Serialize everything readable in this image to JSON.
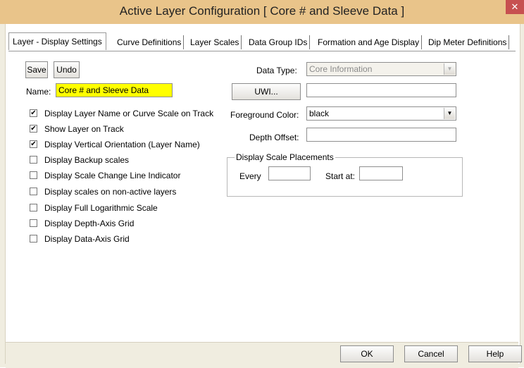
{
  "window": {
    "title": "Active Layer Configuration   [ Core # and Sleeve Data ]",
    "close_glyph": "✕"
  },
  "tabs": [
    {
      "label": "Layer - Display Settings",
      "active": true
    },
    {
      "label": "Curve Definitions"
    },
    {
      "label": "Layer Scales"
    },
    {
      "label": "Data Group IDs"
    },
    {
      "label": "Formation and Age Display"
    },
    {
      "label": "Dip Meter Definitions"
    }
  ],
  "left": {
    "save_label": "Save",
    "undo_label": "Undo",
    "name_label": "Name:",
    "name_value": "Core # and Sleeve Data",
    "checkboxes": [
      {
        "label": "Display Layer Name or Curve Scale on Track",
        "checked": true
      },
      {
        "label": "Show Layer on Track",
        "checked": true
      },
      {
        "label": "Display Vertical Orientation (Layer Name)",
        "checked": true
      },
      {
        "label": "Display Backup scales",
        "checked": false
      },
      {
        "label": "Display Scale Change Line Indicator",
        "checked": false
      },
      {
        "label": "Display scales on non-active layers",
        "checked": false
      },
      {
        "label": "Display Full Logarithmic Scale",
        "checked": false
      },
      {
        "label": "Display Depth-Axis Grid",
        "checked": false
      },
      {
        "label": "Display Data-Axis Grid",
        "checked": false
      }
    ],
    "check_glyph": "✔"
  },
  "right": {
    "data_type_label": "Data Type:",
    "data_type_value": "Core Information",
    "uwi_button": "UWI...",
    "uwi_value": "",
    "fg_color_label": "Foreground Color:",
    "fg_color_value": "black",
    "depth_offset_label": "Depth Offset:",
    "depth_offset_value": "",
    "scale_group_title": "Display Scale Placements",
    "every_label": "Every",
    "every_value": "",
    "start_at_label": "Start at:",
    "start_at_value": ""
  },
  "footer": {
    "ok_label": "OK",
    "cancel_label": "Cancel",
    "help_label": "Help"
  },
  "icons": {
    "dropdown": "▼",
    "close": "close-icon"
  },
  "colors": {
    "titlebar": "#e9c48a",
    "name_highlight": "#ffff00",
    "close": "#c75050"
  }
}
